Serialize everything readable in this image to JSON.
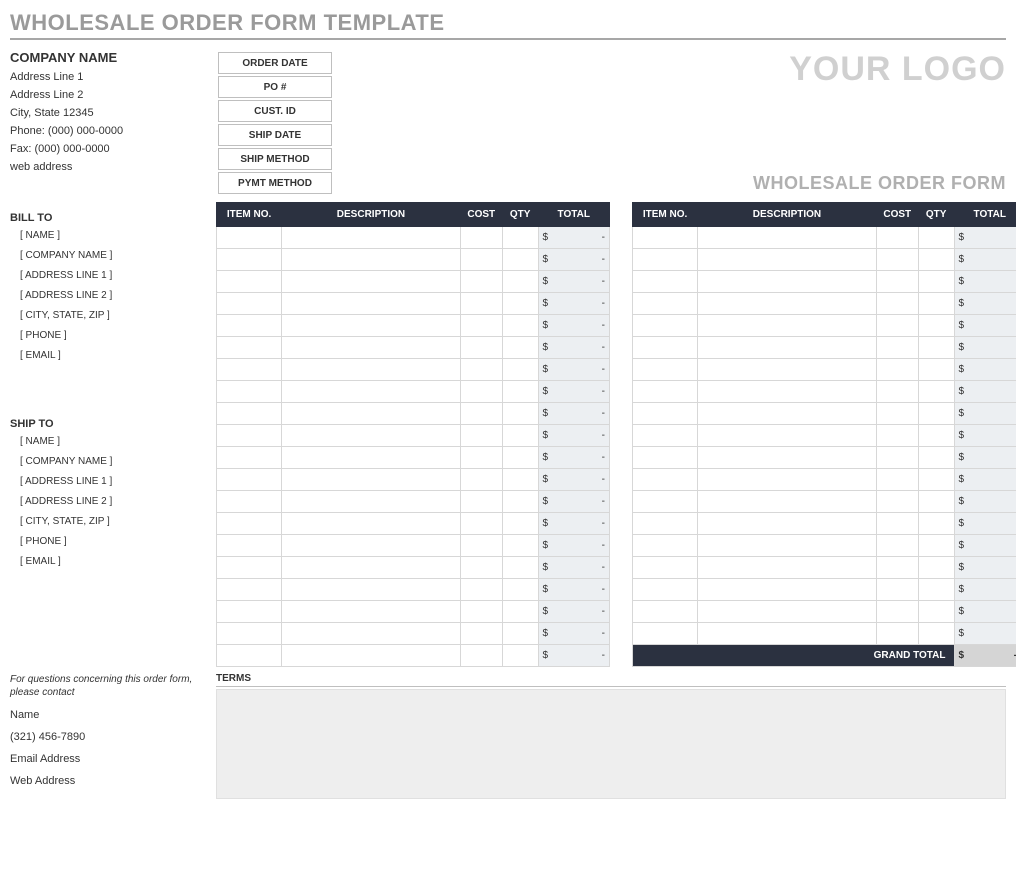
{
  "title": "WHOLESALE ORDER FORM TEMPLATE",
  "logo_text": "YOUR LOGO",
  "subtitle": "WHOLESALE ORDER FORM",
  "company": {
    "name": "COMPANY NAME",
    "addr1": "Address Line 1",
    "addr2": "Address Line 2",
    "citystate": "City, State  12345",
    "phone": "Phone: (000) 000-0000",
    "fax": "Fax: (000) 000-0000",
    "web": "web address"
  },
  "order_meta": [
    "ORDER DATE",
    "PO #",
    "CUST. ID",
    "SHIP DATE",
    "SHIP METHOD",
    "PYMT METHOD"
  ],
  "bill_to": {
    "heading": "BILL TO",
    "fields": [
      "[ NAME ]",
      "[ COMPANY NAME ]",
      "[ ADDRESS LINE 1 ]",
      "[ ADDRESS LINE 2 ]",
      "[ CITY, STATE, ZIP ]",
      "[ PHONE ]",
      "[ EMAIL ]"
    ]
  },
  "ship_to": {
    "heading": "SHIP TO",
    "fields": [
      "[ NAME ]",
      "[ COMPANY NAME ]",
      "[ ADDRESS LINE 1 ]",
      "[ ADDRESS LINE 2 ]",
      "[ CITY, STATE, ZIP ]",
      "[ PHONE ]",
      "[ EMAIL ]"
    ]
  },
  "item_headers": [
    "ITEM NO.",
    "DESCRIPTION",
    "COST",
    "QTY",
    "TOTAL"
  ],
  "total_cell": {
    "sym": "$",
    "dash": "-"
  },
  "left_rows": 20,
  "right_rows": 19,
  "grand_total_label": "GRAND TOTAL",
  "contact_note": "For questions concerning this order form, please contact",
  "contact": [
    "Name",
    "(321) 456-7890",
    "Email Address",
    "Web Address"
  ],
  "terms_label": "TERMS"
}
